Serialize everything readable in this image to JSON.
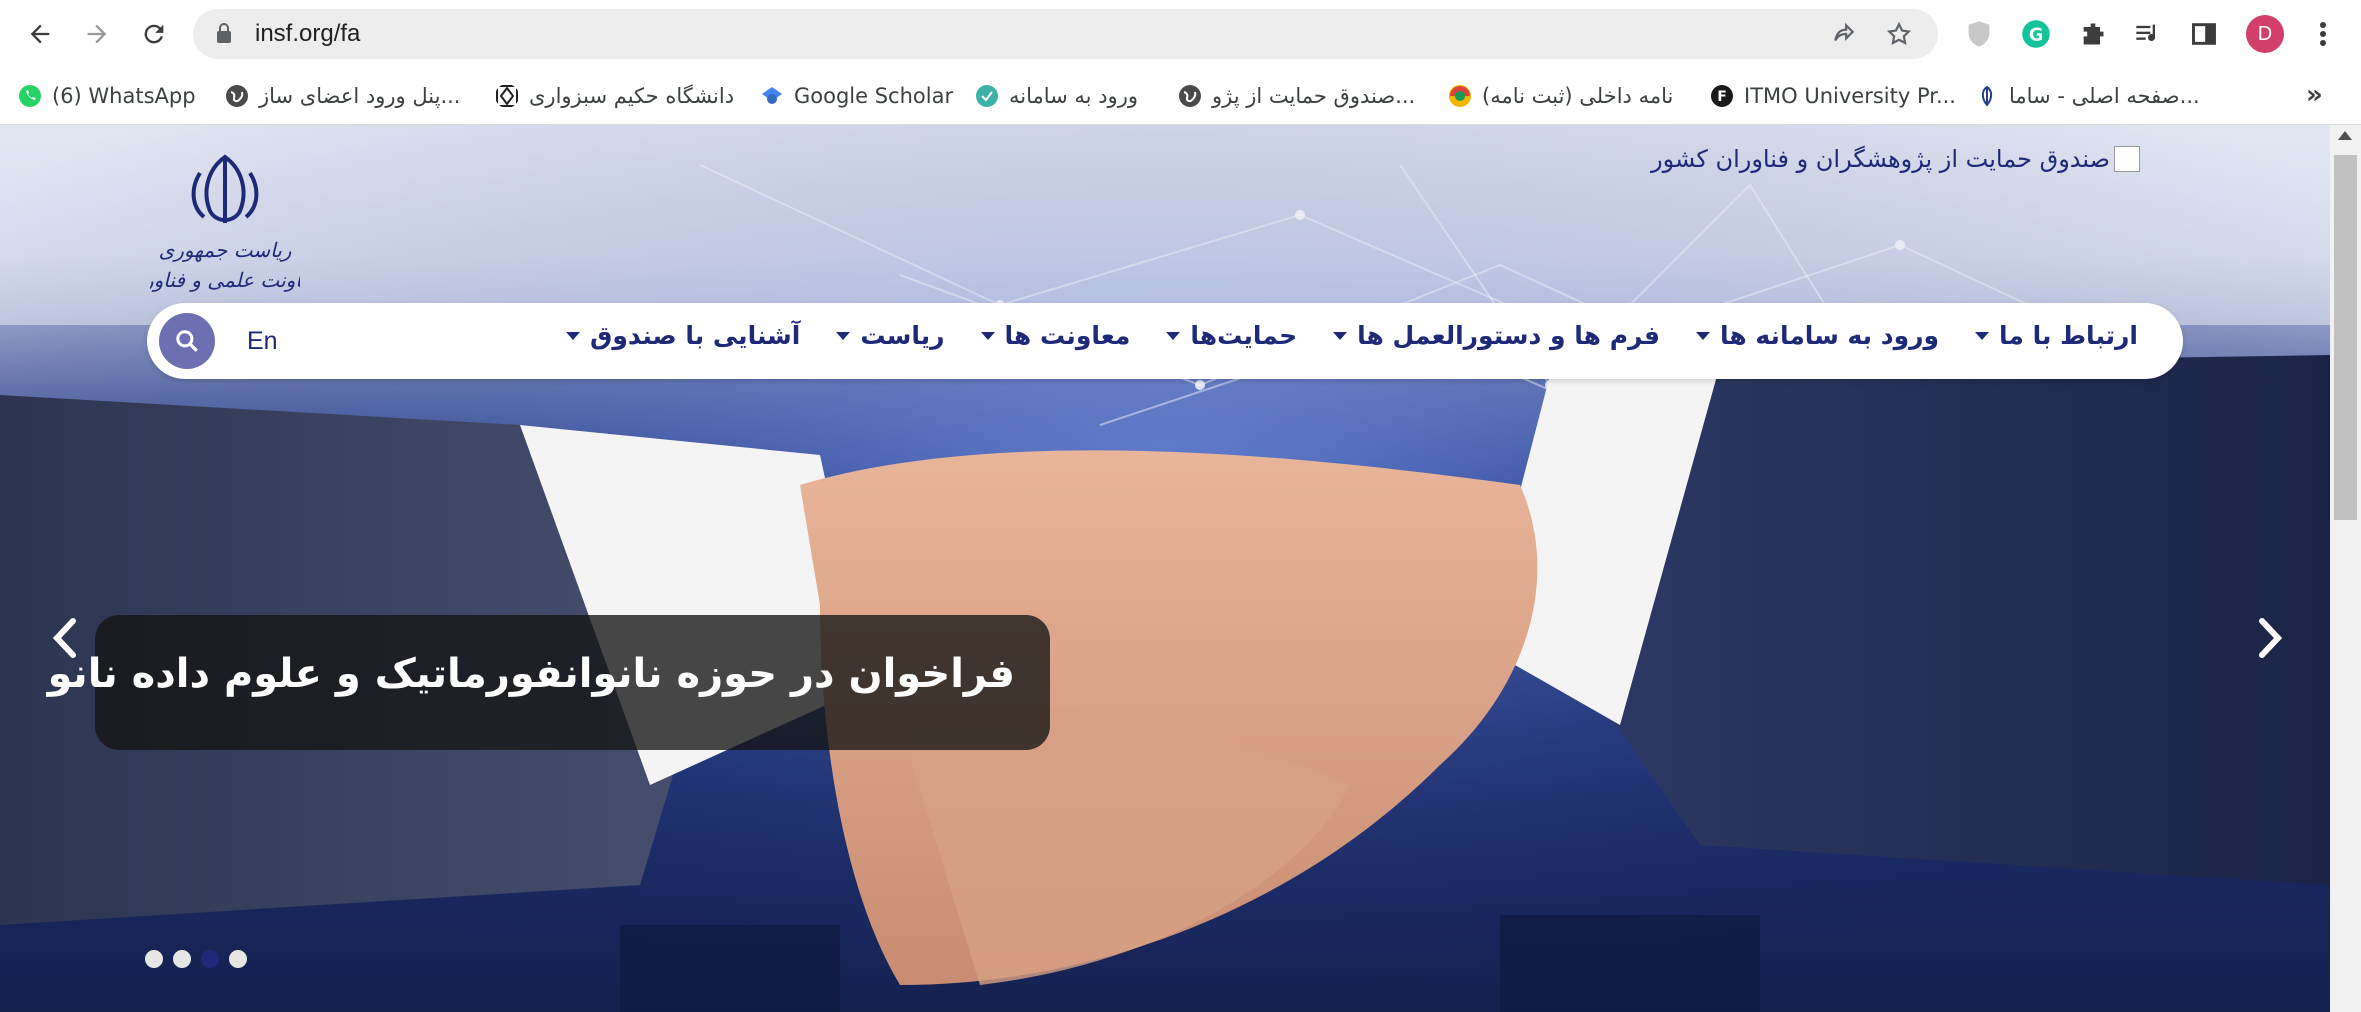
{
  "browser": {
    "url": "insf.org/fa",
    "avatar_letter": "D",
    "accent": "#d23f6b"
  },
  "bookmarks": [
    {
      "label": "(6) WhatsApp",
      "icon": "whatsapp-icon"
    },
    {
      "label": "پنل ورود اعضای ساز...",
      "icon": "globe-icon"
    },
    {
      "label": "دانشگاه حکیم سبزواری",
      "icon": "university-icon"
    },
    {
      "label": "Google Scholar",
      "icon": "scholar-icon"
    },
    {
      "label": "ورود به سامانه",
      "icon": "system-icon"
    },
    {
      "label": "صندوق حمایت از پژو...",
      "icon": "globe-icon"
    },
    {
      "label": "نامه داخلی (ثبت نامه)",
      "icon": "letter-icon"
    },
    {
      "label": "ITMO University Pr...",
      "icon": "itmo-icon"
    },
    {
      "label": "صفحه اصلی - ساما...",
      "icon": "iran-emblem-icon"
    }
  ],
  "site": {
    "logo_alt": "صندوق حمایت از پژوهشگران و فناوران کشور",
    "emblem_line1": "ریاست جمهوری",
    "emblem_line2": "معاونت علمی و فناوری",
    "lang": "En",
    "menu": [
      "آشنایی با صندوق",
      "ریاست",
      "معاونت ها",
      "حمایت‌ها",
      "فرم ها و دستورالعمل ها",
      "ورود به سامانه ها",
      "ارتباط با ما"
    ],
    "slide_caption": "فراخوان در حوزه نانوانفورماتیک و علوم داده نانو",
    "slides_count": 4,
    "active_slide": 3,
    "brand_color": "#1e2a78"
  }
}
